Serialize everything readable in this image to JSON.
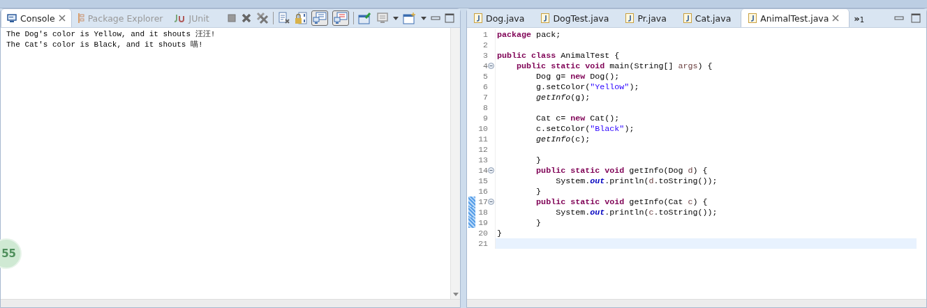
{
  "left_panel": {
    "tabs": [
      {
        "label": "Console",
        "kind": "console",
        "selected": true,
        "closable": true
      },
      {
        "label": "Package Explorer",
        "kind": "package",
        "selected": false
      },
      {
        "label": "JUnit",
        "kind": "junit",
        "selected": false
      }
    ],
    "toolbar": [
      {
        "kind": "stop"
      },
      {
        "kind": "remove"
      },
      {
        "kind": "remove-all"
      },
      {
        "kind": "sep"
      },
      {
        "kind": "clear"
      },
      {
        "kind": "lock"
      },
      {
        "kind": "show-out",
        "selected": true
      },
      {
        "kind": "show-err",
        "selected": true
      },
      {
        "kind": "sep"
      },
      {
        "kind": "pin"
      },
      {
        "kind": "display"
      },
      {
        "kind": "dropdown"
      },
      {
        "kind": "new-console"
      },
      {
        "kind": "dropdown"
      },
      {
        "kind": "minimize"
      },
      {
        "kind": "maximize"
      }
    ],
    "console_lines": [
      "The Dog's color is Yellow, and it shouts 汪汪!",
      "The Cat's color is Black, and it shouts 喵!"
    ],
    "badge": "55"
  },
  "editor": {
    "tabs": [
      {
        "label": "Dog.java",
        "selected": false
      },
      {
        "label": "DogTest.java",
        "selected": false
      },
      {
        "label": "Pr.java",
        "selected": false
      },
      {
        "label": "Cat.java",
        "selected": false
      },
      {
        "label": "AnimalTest.java",
        "selected": true,
        "closable": true
      }
    ],
    "overflow": {
      "chevron": "»",
      "count": "1"
    },
    "lines": [
      {
        "number": "1",
        "tokens": [
          {
            "kind": "kw",
            "t": "package"
          },
          {
            "kind": "txt",
            "t": " pack;"
          }
        ]
      },
      {
        "number": "2"
      },
      {
        "number": "3",
        "tokens": [
          {
            "kind": "kw",
            "t": "public class"
          },
          {
            "kind": "txt",
            "t": " AnimalTest {"
          }
        ]
      },
      {
        "number": "4",
        "fold": true,
        "tokens": [
          {
            "kind": "kw",
            "t": "    public static void"
          },
          {
            "kind": "txt",
            "t": " main(String[] "
          },
          {
            "kind": "param",
            "t": "args"
          },
          {
            "kind": "txt",
            "t": ") {"
          }
        ]
      },
      {
        "number": "5",
        "tokens": [
          {
            "kind": "txt",
            "t": "        Dog g= "
          },
          {
            "kind": "kw",
            "t": "new"
          },
          {
            "kind": "txt",
            "t": " Dog();"
          }
        ]
      },
      {
        "number": "6",
        "tokens": [
          {
            "kind": "txt",
            "t": "        g.setColor("
          },
          {
            "kind": "str",
            "t": "\"Yellow\""
          },
          {
            "kind": "txt",
            "t": ");"
          }
        ]
      },
      {
        "number": "7",
        "tokens": [
          {
            "kind": "call",
            "t": "        getInfo"
          },
          {
            "kind": "txt",
            "t": "(g);"
          }
        ]
      },
      {
        "number": "8"
      },
      {
        "number": "9",
        "tokens": [
          {
            "kind": "txt",
            "t": "        Cat c= "
          },
          {
            "kind": "kw",
            "t": "new"
          },
          {
            "kind": "txt",
            "t": " Cat();"
          }
        ]
      },
      {
        "number": "10",
        "tokens": [
          {
            "kind": "txt",
            "t": "        c.setColor("
          },
          {
            "kind": "str",
            "t": "\"Black\""
          },
          {
            "kind": "txt",
            "t": ");"
          }
        ]
      },
      {
        "number": "11",
        "tokens": [
          {
            "kind": "call",
            "t": "        getInfo"
          },
          {
            "kind": "txt",
            "t": "(c);"
          }
        ]
      },
      {
        "number": "12"
      },
      {
        "number": "13",
        "tokens": [
          {
            "kind": "txt",
            "t": "        }"
          }
        ]
      },
      {
        "number": "14",
        "fold": true,
        "tokens": [
          {
            "kind": "kw",
            "t": "        public static void"
          },
          {
            "kind": "txt",
            "t": " getInfo(Dog "
          },
          {
            "kind": "param",
            "t": "d"
          },
          {
            "kind": "txt",
            "t": ") {"
          }
        ]
      },
      {
        "number": "15",
        "tokens": [
          {
            "kind": "txt",
            "t": "            System."
          },
          {
            "kind": "field",
            "t": "out"
          },
          {
            "kind": "txt",
            "t": ".println("
          },
          {
            "kind": "param",
            "t": "d"
          },
          {
            "kind": "txt",
            "t": ".toString());"
          }
        ]
      },
      {
        "number": "16",
        "tokens": [
          {
            "kind": "txt",
            "t": "        }"
          }
        ]
      },
      {
        "number": "17",
        "fold": true,
        "changed": true,
        "tokens": [
          {
            "kind": "kw",
            "t": "        public static void"
          },
          {
            "kind": "txt",
            "t": " getInfo(Cat "
          },
          {
            "kind": "param",
            "t": "c"
          },
          {
            "kind": "txt",
            "t": ") {"
          }
        ]
      },
      {
        "number": "18",
        "changed": true,
        "tokens": [
          {
            "kind": "txt",
            "t": "            System."
          },
          {
            "kind": "field",
            "t": "out"
          },
          {
            "kind": "txt",
            "t": ".println("
          },
          {
            "kind": "param",
            "t": "c"
          },
          {
            "kind": "txt",
            "t": ".toString());"
          }
        ]
      },
      {
        "number": "19",
        "changed": true,
        "tokens": [
          {
            "kind": "txt",
            "t": "        }"
          }
        ]
      },
      {
        "number": "20",
        "tokens": [
          {
            "kind": "txt",
            "t": "}"
          }
        ]
      },
      {
        "number": "21",
        "current": true
      }
    ]
  }
}
